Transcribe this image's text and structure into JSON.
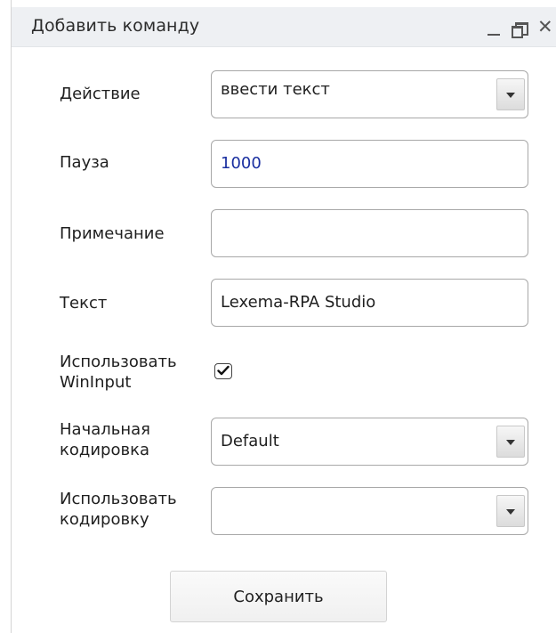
{
  "window": {
    "title": "Добавить команду",
    "controls": {
      "minimize": "minimize-icon",
      "restore": "restore-icon",
      "close": "close-icon"
    }
  },
  "form": {
    "action": {
      "label": "Действие",
      "value": "ввести текст"
    },
    "pause": {
      "label": "Пауза",
      "value": "1000"
    },
    "note": {
      "label": "Примечание",
      "value": ""
    },
    "text": {
      "label": "Текст",
      "value": "Lexema-RPA Studio"
    },
    "use_wininput": {
      "label_line1": "Использовать",
      "label_line2": "WinInput",
      "checked": true
    },
    "initial_encoding": {
      "label_line1": "Начальная",
      "label_line2": "кодировка",
      "value": "Default"
    },
    "use_encoding": {
      "label_line1": "Использовать",
      "label_line2": "кодировку",
      "value": ""
    }
  },
  "actions": {
    "save_label": "Сохранить"
  },
  "colors": {
    "titlebar_bg": "#eef0f3",
    "pause_value_color": "#1a2fa0",
    "field_border": "#a8a8a8"
  }
}
